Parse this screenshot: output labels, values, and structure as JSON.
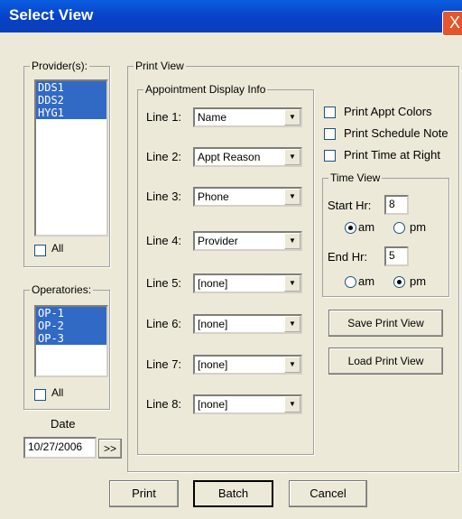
{
  "window": {
    "title": "Select View",
    "close_glyph": "X"
  },
  "providers": {
    "legend": "Provider(s):",
    "items": [
      "DDS1",
      "DDS2",
      "HYG1"
    ],
    "all_label": "All"
  },
  "operatories": {
    "legend": "Operatories:",
    "items": [
      "OP-1",
      "OP-2",
      "OP-3"
    ],
    "all_label": "All"
  },
  "date": {
    "label": "Date",
    "value": "10/27/2006",
    "picker_label": ">>"
  },
  "print_view": {
    "legend": "Print View"
  },
  "appt_display": {
    "legend": "Appointment Display Info",
    "lines": [
      {
        "label": "Line 1:",
        "value": "Name"
      },
      {
        "label": "Line 2:",
        "value": "Appt Reason"
      },
      {
        "label": "Line 3:",
        "value": "Phone"
      },
      {
        "label": "Line 4:",
        "value": "Provider"
      },
      {
        "label": "Line 5:",
        "value": "[none]"
      },
      {
        "label": "Line 6:",
        "value": "[none]"
      },
      {
        "label": "Line 7:",
        "value": "[none]"
      },
      {
        "label": "Line 8:",
        "value": "[none]"
      }
    ]
  },
  "options": {
    "print_appt_colors": "Print Appt Colors",
    "print_schedule_note": "Print Schedule Note",
    "print_time_at_right": "Print Time at Right"
  },
  "time_view": {
    "legend": "Time View",
    "start_label": "Start Hr:",
    "start_value": "8",
    "end_label": "End Hr:",
    "end_value": "5",
    "am": "am",
    "pm": "pm",
    "start_selected": "am",
    "end_selected": "pm"
  },
  "buttons": {
    "save_print_view": "Save Print View",
    "load_print_view": "Load Print View",
    "print": "Print",
    "batch": "Batch",
    "cancel": "Cancel"
  }
}
